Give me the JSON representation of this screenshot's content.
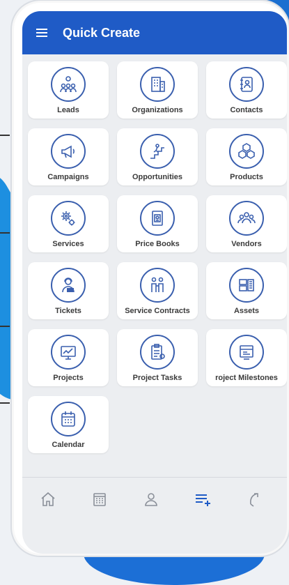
{
  "appbar": {
    "title": "Quick Create"
  },
  "tiles": [
    {
      "label": "Leads",
      "icon": "people-hierarchy-icon"
    },
    {
      "label": "Organizations",
      "icon": "building-icon"
    },
    {
      "label": "Contacts",
      "icon": "address-book-icon"
    },
    {
      "label": "Campaigns",
      "icon": "megaphone-icon"
    },
    {
      "label": "Opportunities",
      "icon": "climbing-stairs-icon"
    },
    {
      "label": "Products",
      "icon": "boxes-icon"
    },
    {
      "label": "Services",
      "icon": "gears-icon"
    },
    {
      "label": "Price Books",
      "icon": "price-book-icon"
    },
    {
      "label": "Vendors",
      "icon": "vendors-group-icon"
    },
    {
      "label": "Tickets",
      "icon": "support-agent-icon"
    },
    {
      "label": "Service Contracts",
      "icon": "handshake-icon"
    },
    {
      "label": "Assets",
      "icon": "assets-icon"
    },
    {
      "label": "Projects",
      "icon": "project-board-icon"
    },
    {
      "label": "Project Tasks",
      "icon": "task-clipboard-icon"
    },
    {
      "label": "roject Milestones",
      "icon": "milestone-icon"
    },
    {
      "label": "Calendar",
      "icon": "calendar-icon"
    }
  ],
  "bottom_nav": [
    {
      "name": "home-icon"
    },
    {
      "name": "calendar-icon"
    },
    {
      "name": "person-icon"
    },
    {
      "name": "quick-create-icon",
      "active": true
    },
    {
      "name": "history-icon"
    }
  ],
  "colors": {
    "primary": "#1f5bc6",
    "icon_stroke": "#3a5fae",
    "background": "#eceef1"
  }
}
